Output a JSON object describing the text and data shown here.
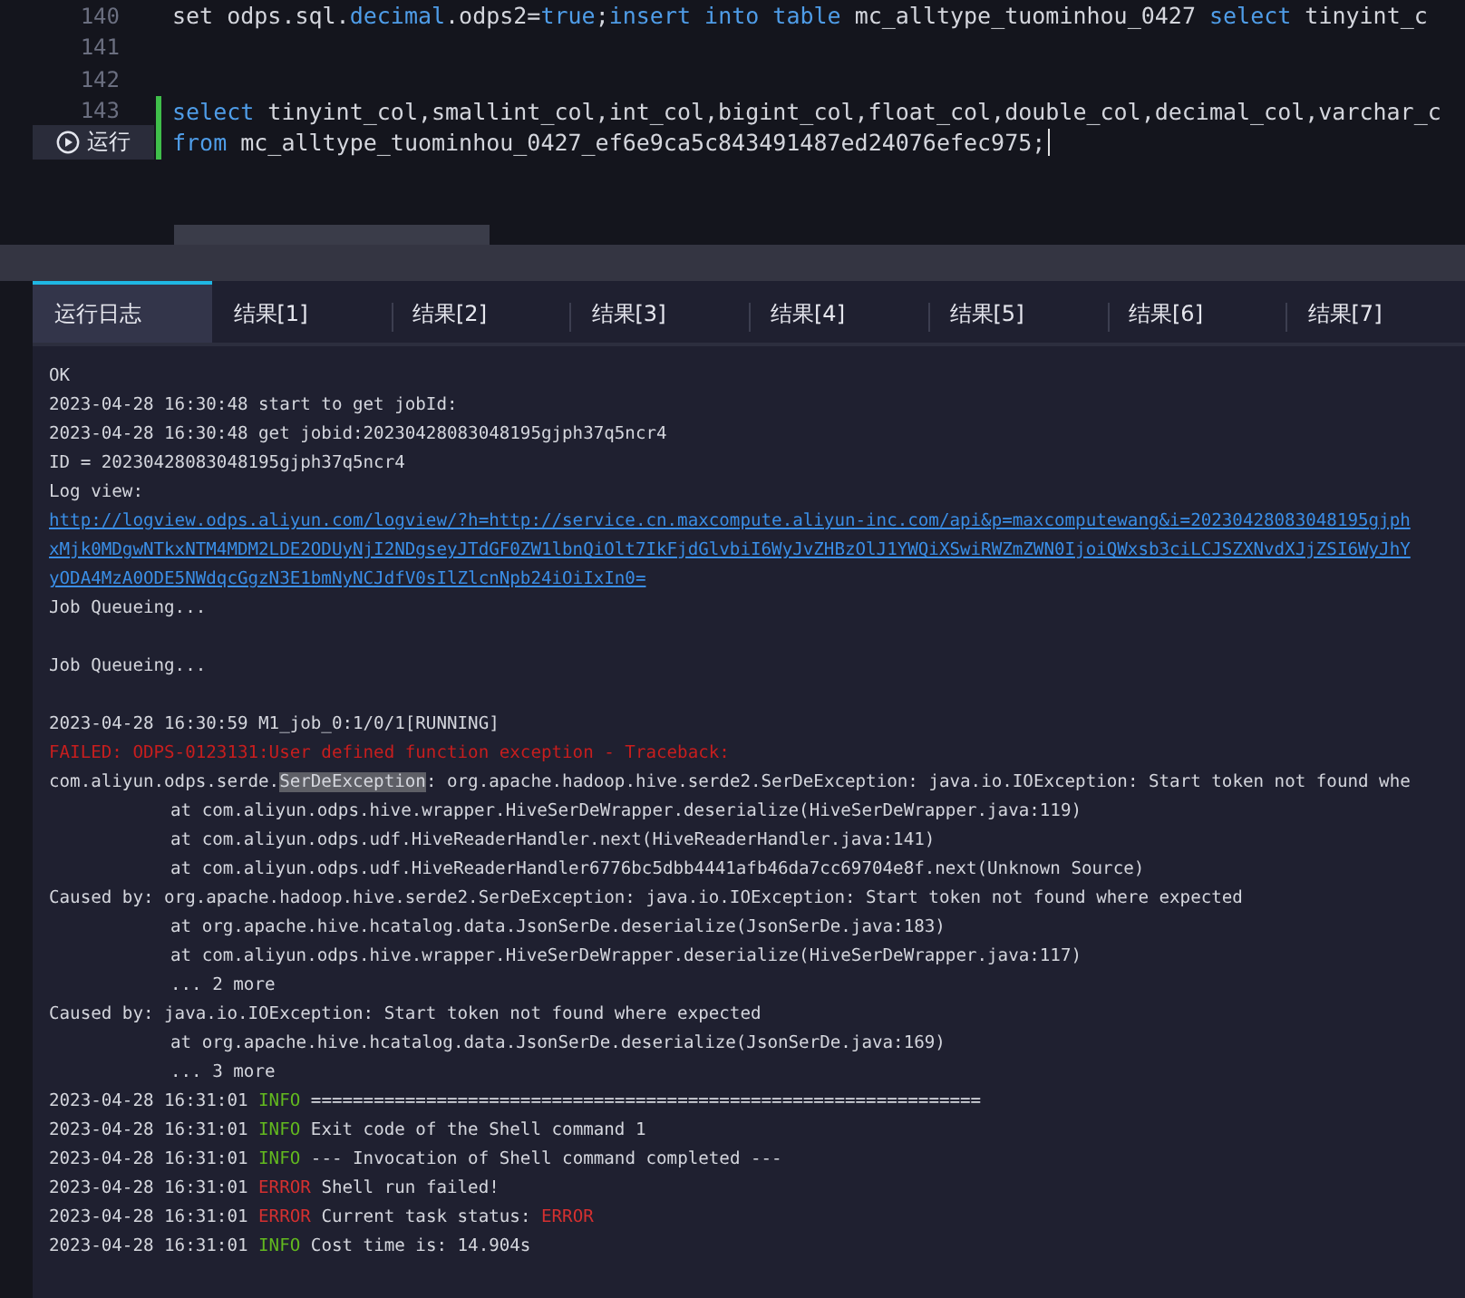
{
  "editor": {
    "lines": [
      {
        "number": "140",
        "modified": false,
        "cursor": false,
        "tokens": [
          {
            "text": "set odps.sql.",
            "kind": "plain"
          },
          {
            "text": "decimal",
            "kind": "keyword"
          },
          {
            "text": ".odps2=",
            "kind": "plain"
          },
          {
            "text": "true",
            "kind": "keyword"
          },
          {
            "text": ";",
            "kind": "plain"
          },
          {
            "text": "insert into table",
            "kind": "keyword"
          },
          {
            "text": " mc_alltype_tuominhou_0427 ",
            "kind": "plain"
          },
          {
            "text": "select",
            "kind": "keyword"
          },
          {
            "text": " tinyint_c",
            "kind": "plain"
          }
        ]
      },
      {
        "number": "141",
        "modified": false,
        "cursor": false
      },
      {
        "number": "142",
        "modified": false,
        "cursor": false
      },
      {
        "number": "143",
        "modified": true,
        "cursor": false,
        "tokens": [
          {
            "text": "select",
            "kind": "keyword"
          },
          {
            "text": " tinyint_col,smallint_col,int_col,bigint_col,float_col,double_col,decimal_col,varchar_c",
            "kind": "plain"
          }
        ]
      },
      {
        "run_label": "运行",
        "modified": true,
        "cursor": true,
        "tokens": [
          {
            "text": "from",
            "kind": "keyword"
          },
          {
            "text": " mc_alltype_tuominhou_0427_ef6e9ca5c843491487ed24076efec975;",
            "kind": "plain"
          }
        ]
      }
    ]
  },
  "tabs": [
    {
      "label": "运行日志",
      "selected": true
    },
    {
      "label": "结果[1]",
      "selected": false
    },
    {
      "label": "结果[2]",
      "selected": false
    },
    {
      "label": "结果[3]",
      "selected": false
    },
    {
      "label": "结果[4]",
      "selected": false
    },
    {
      "label": "结果[5]",
      "selected": false
    },
    {
      "label": "结果[6]",
      "selected": false
    },
    {
      "label": "结果[7]",
      "selected": false
    }
  ],
  "log": [
    {
      "kind": "text",
      "indent": false,
      "segments": [
        {
          "text": "OK",
          "kind": "plain"
        }
      ]
    },
    {
      "kind": "text",
      "indent": false,
      "segments": [
        {
          "text": "2023-04-28 16:30:48 start to get jobId:",
          "kind": "plain"
        }
      ]
    },
    {
      "kind": "text",
      "indent": false,
      "segments": [
        {
          "text": "2023-04-28 16:30:48 get jobid:20230428083048195gjph37q5ncr4",
          "kind": "plain"
        }
      ]
    },
    {
      "kind": "text",
      "indent": false,
      "segments": [
        {
          "text": "ID = 20230428083048195gjph37q5ncr4",
          "kind": "plain"
        }
      ]
    },
    {
      "kind": "text",
      "indent": false,
      "segments": [
        {
          "text": "Log view:",
          "kind": "plain"
        }
      ]
    },
    {
      "kind": "text",
      "indent": false,
      "segments": [
        {
          "text": "http://logview.odps.aliyun.com/logview/?h=http://service.cn.maxcompute.aliyun-inc.com/api&p=maxcomputewang&i=20230428083048195gjph",
          "kind": "link"
        }
      ]
    },
    {
      "kind": "text",
      "indent": false,
      "segments": [
        {
          "text": "xMjk0MDgwNTkxNTM4MDM2LDE2ODUyNjI2NDgseyJTdGF0ZW1lbnQiOlt7IkFjdGlvbiI6WyJvZHBzOlJ1YWQiXSwiRWZmZWN0IjoiQWxsb3ciLCJSZXNvdXJjZSI6WyJhY",
          "kind": "link"
        }
      ]
    },
    {
      "kind": "text",
      "indent": false,
      "segments": [
        {
          "text": "yODA4MzA0ODE5NWdqcGgzN3E1bmNyNCJdfV0sIlZlcnNpb24iOiIxIn0=",
          "kind": "link"
        }
      ]
    },
    {
      "kind": "text",
      "indent": false,
      "segments": [
        {
          "text": "Job Queueing...",
          "kind": "plain"
        }
      ]
    },
    {
      "kind": "blank"
    },
    {
      "kind": "text",
      "indent": false,
      "segments": [
        {
          "text": "Job Queueing...",
          "kind": "plain"
        }
      ]
    },
    {
      "kind": "blank"
    },
    {
      "kind": "text",
      "indent": false,
      "segments": [
        {
          "text": "2023-04-28 16:30:59 M1_job_0:1/0/1[RUNNING]",
          "kind": "plain"
        }
      ]
    },
    {
      "kind": "text",
      "indent": false,
      "segments": [
        {
          "text": "FAILED: ODPS-0123131:User defined function exception - Traceback:",
          "kind": "failed"
        }
      ]
    },
    {
      "kind": "text",
      "indent": false,
      "segments": [
        {
          "text": "com.aliyun.odps.serde.",
          "kind": "plain"
        },
        {
          "text": "SerDeException",
          "kind": "selection"
        },
        {
          "text": ": org.apache.hadoop.hive.serde2.SerDeException: java.io.IOException: Start token not found whe",
          "kind": "plain"
        }
      ]
    },
    {
      "kind": "text",
      "indent": true,
      "segments": [
        {
          "text": "at com.aliyun.odps.hive.wrapper.HiveSerDeWrapper.deserialize(HiveSerDeWrapper.java:119)",
          "kind": "plain"
        }
      ]
    },
    {
      "kind": "text",
      "indent": true,
      "segments": [
        {
          "text": "at com.aliyun.odps.udf.HiveReaderHandler.next(HiveReaderHandler.java:141)",
          "kind": "plain"
        }
      ]
    },
    {
      "kind": "text",
      "indent": true,
      "segments": [
        {
          "text": "at com.aliyun.odps.udf.HiveReaderHandler6776bc5dbb4441afb46da7cc69704e8f.next(Unknown Source)",
          "kind": "plain"
        }
      ]
    },
    {
      "kind": "text",
      "indent": false,
      "segments": [
        {
          "text": "Caused by: org.apache.hadoop.hive.serde2.SerDeException: java.io.IOException: Start token not found where expected",
          "kind": "plain"
        }
      ]
    },
    {
      "kind": "text",
      "indent": true,
      "segments": [
        {
          "text": "at org.apache.hive.hcatalog.data.JsonSerDe.deserialize(JsonSerDe.java:183)",
          "kind": "plain"
        }
      ]
    },
    {
      "kind": "text",
      "indent": true,
      "segments": [
        {
          "text": "at com.aliyun.odps.hive.wrapper.HiveSerDeWrapper.deserialize(HiveSerDeWrapper.java:117)",
          "kind": "plain"
        }
      ]
    },
    {
      "kind": "text",
      "indent": true,
      "segments": [
        {
          "text": "... 2 more",
          "kind": "plain"
        }
      ]
    },
    {
      "kind": "text",
      "indent": false,
      "segments": [
        {
          "text": "Caused by: java.io.IOException: Start token not found where expected",
          "kind": "plain"
        }
      ]
    },
    {
      "kind": "text",
      "indent": true,
      "segments": [
        {
          "text": "at org.apache.hive.hcatalog.data.JsonSerDe.deserialize(JsonSerDe.java:169)",
          "kind": "plain"
        }
      ]
    },
    {
      "kind": "text",
      "indent": true,
      "segments": [
        {
          "text": "... 3 more",
          "kind": "plain"
        }
      ]
    },
    {
      "kind": "text",
      "indent": false,
      "segments": [
        {
          "text": "2023-04-28 16:31:01 ",
          "kind": "plain"
        },
        {
          "text": "INFO",
          "kind": "info"
        },
        {
          "text": " ================================================================",
          "kind": "plain"
        }
      ]
    },
    {
      "kind": "text",
      "indent": false,
      "segments": [
        {
          "text": "2023-04-28 16:31:01 ",
          "kind": "plain"
        },
        {
          "text": "INFO",
          "kind": "info"
        },
        {
          "text": " Exit code of the Shell command 1",
          "kind": "plain"
        }
      ]
    },
    {
      "kind": "text",
      "indent": false,
      "segments": [
        {
          "text": "2023-04-28 16:31:01 ",
          "kind": "plain"
        },
        {
          "text": "INFO",
          "kind": "info"
        },
        {
          "text": " --- Invocation of Shell command completed ---",
          "kind": "plain"
        }
      ]
    },
    {
      "kind": "text",
      "indent": false,
      "segments": [
        {
          "text": "2023-04-28 16:31:01 ",
          "kind": "plain"
        },
        {
          "text": "ERROR",
          "kind": "error"
        },
        {
          "text": " Shell run failed!",
          "kind": "plain"
        }
      ]
    },
    {
      "kind": "text",
      "indent": false,
      "segments": [
        {
          "text": "2023-04-28 16:31:01 ",
          "kind": "plain"
        },
        {
          "text": "ERROR",
          "kind": "error"
        },
        {
          "text": " Current task status: ",
          "kind": "plain"
        },
        {
          "text": "ERROR",
          "kind": "error"
        }
      ]
    },
    {
      "kind": "text",
      "indent": false,
      "segments": [
        {
          "text": "2023-04-28 16:31:01 ",
          "kind": "plain"
        },
        {
          "text": "INFO",
          "kind": "info"
        },
        {
          "text": " Cost time is: 14.904s",
          "kind": "plain"
        }
      ]
    }
  ]
}
